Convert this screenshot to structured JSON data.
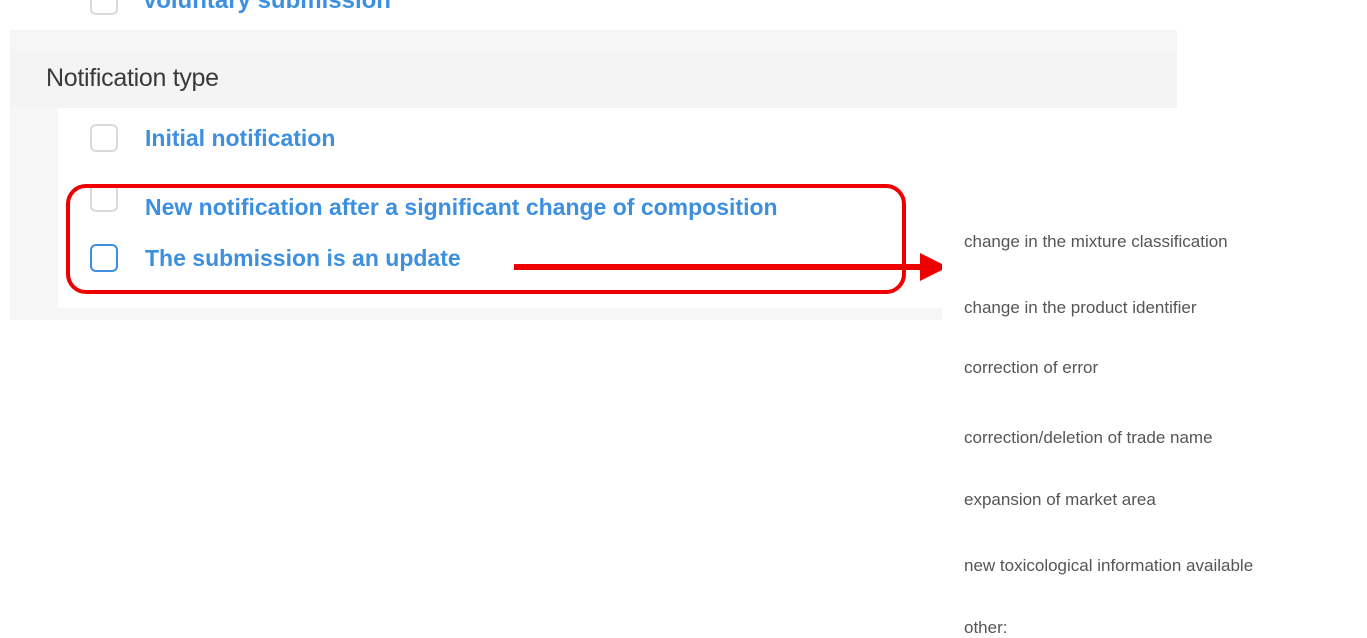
{
  "previous_option": {
    "label": "Voluntary submission"
  },
  "notification_type": {
    "title": "Notification type",
    "options": [
      {
        "label": "Initial notification",
        "checked": false
      },
      {
        "label": "New notification after a significant change of composition",
        "checked": false
      },
      {
        "label": "The submission is an update",
        "checked": false
      }
    ]
  },
  "annotation": {
    "color": "#ee0000"
  },
  "update_reasons": {
    "items": [
      "change in the mixture classification",
      "change in the product identifier",
      "correction of error",
      "correction/deletion of trade name",
      "expansion of market area",
      "new toxicological information available",
      "other:"
    ]
  },
  "colors": {
    "link_blue": "#3d8fe0",
    "text_gray": "#555555",
    "title_dark": "#3a3a3a"
  }
}
